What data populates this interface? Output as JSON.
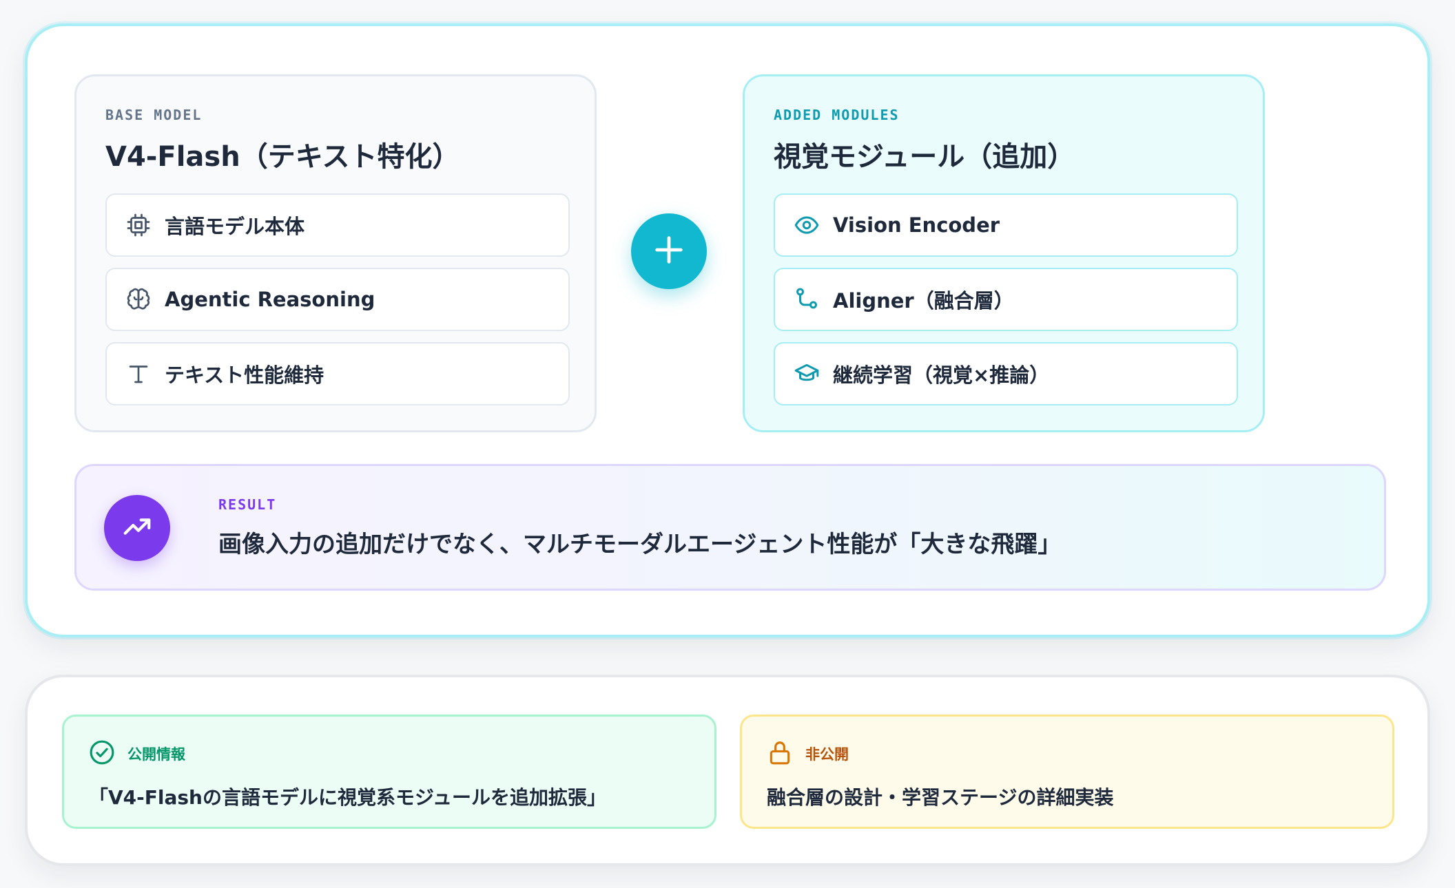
{
  "base": {
    "eyebrow": "BASE MODEL",
    "title": "V4-Flash（テキスト特化）",
    "items": [
      {
        "label": "言語モデル本体",
        "icon": "cpu-chip-icon"
      },
      {
        "label": "Agentic Reasoning",
        "icon": "brain-icon"
      },
      {
        "label": "テキスト性能維持",
        "icon": "text-type-icon"
      }
    ]
  },
  "added": {
    "eyebrow": "ADDED MODULES",
    "title": "視覚モジュール（追加）",
    "items": [
      {
        "label": "Vision Encoder",
        "icon": "eye-icon"
      },
      {
        "label": "Aligner（融合層）",
        "icon": "merge-branch-icon"
      },
      {
        "label": "継続学習（視覚×推論）",
        "icon": "graduation-cap-icon"
      }
    ]
  },
  "plus_icon": "plus-icon",
  "result": {
    "eyebrow": "RESULT",
    "text": "画像入力の追加だけでなく、マルチモーダルエージェント性能が「大きな飛躍」",
    "icon": "trending-up-icon"
  },
  "public_info": {
    "tag": "公開情報",
    "text": "「V4-Flashの言語モデルに視覚系モジュールを追加拡張」",
    "icon": "check-circle-icon"
  },
  "private_info": {
    "tag": "非公開",
    "text": "融合層の設計・学習ステージの詳細実装",
    "icon": "lock-icon"
  },
  "colors": {
    "cyan_accent": "#11b8cf",
    "purple_accent": "#7c3aed",
    "green_accent": "#059669",
    "amber_accent": "#b45309",
    "text_dark": "#1e293b"
  }
}
